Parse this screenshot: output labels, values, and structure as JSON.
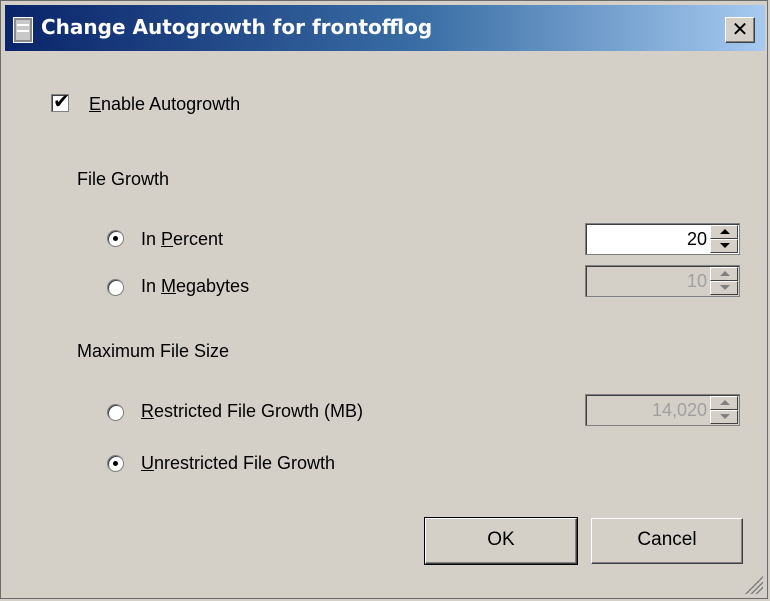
{
  "window": {
    "title": "Change Autogrowth for frontofflog",
    "close_glyph": "✕"
  },
  "autogrowth": {
    "enable_label_key": "E",
    "enable_label_rest": "nable Autogrowth",
    "enabled": true
  },
  "file_growth": {
    "heading": "File Growth",
    "percent_label_pre": "In ",
    "percent_label_key": "P",
    "percent_label_rest": "ercent",
    "percent_value": "20",
    "megabytes_label_pre": "In ",
    "megabytes_label_key": "M",
    "megabytes_label_rest": "egabytes",
    "megabytes_value": "10",
    "selected": "percent"
  },
  "max_size": {
    "heading": "Maximum File Size",
    "restricted_label_key": "R",
    "restricted_label_rest": "estricted File Growth (MB)",
    "restricted_value": "14,020",
    "unrestricted_label_key": "U",
    "unrestricted_label_rest": "nrestricted File Growth",
    "selected": "unrestricted"
  },
  "buttons": {
    "ok": "OK",
    "cancel": "Cancel"
  },
  "icons": {
    "title": "database-file-icon",
    "close": "close-icon",
    "grip": "resize-grip-icon"
  }
}
